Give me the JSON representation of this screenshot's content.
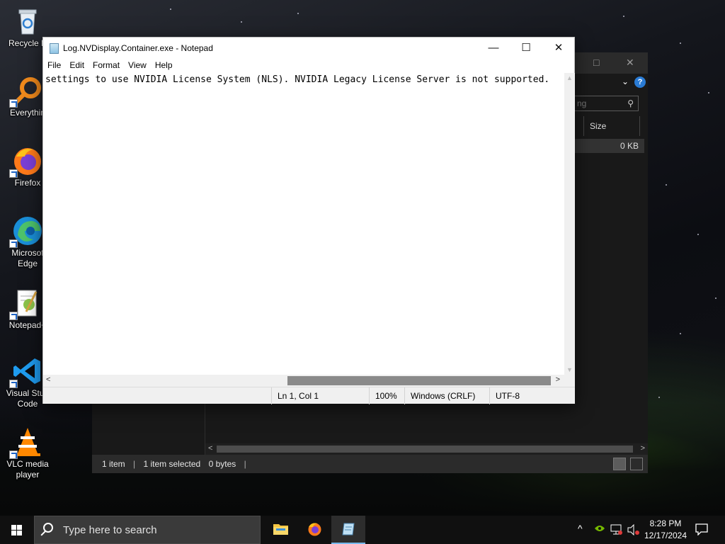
{
  "desktop": {
    "icons": [
      {
        "label": "Recycle Bin",
        "visible_label": "Recycle B",
        "icon": "recycle-bin-icon"
      },
      {
        "label": "Everything",
        "visible_label": "Everythin",
        "icon": "everything-search-icon"
      },
      {
        "label": "Firefox",
        "visible_label": "Firefox",
        "icon": "firefox-icon"
      },
      {
        "label": "Microsoft Edge",
        "visible_label_1": "Microsof",
        "visible_label_2": "Edge",
        "icon": "edge-icon"
      },
      {
        "label": "Notepad++",
        "visible_label": "Notepad+",
        "icon": "notepadpp-icon"
      },
      {
        "label": "Visual Studio Code",
        "visible_label_1": "Visual Stud",
        "visible_label_2": "Code",
        "icon": "vscode-icon"
      },
      {
        "label": "VLC media player",
        "visible_label_1": "VLC media",
        "visible_label_2": "player",
        "icon": "vlc-icon"
      }
    ]
  },
  "explorer": {
    "search_placeholder": "ng",
    "column_size": "Size",
    "row_size": "0 KB",
    "status": {
      "items": "1 item",
      "selected": "1 item selected",
      "bytes": "0 bytes"
    },
    "controls": {
      "maximize": "□",
      "close": "✕",
      "chevron": "⌄",
      "help": "?"
    }
  },
  "notepad": {
    "title": "Log.NVDisplay.Container.exe - Notepad",
    "controls": {
      "minimize": "—",
      "maximize": "☐",
      "close": "✕"
    },
    "menu": [
      "File",
      "Edit",
      "Format",
      "View",
      "Help"
    ],
    "content": "settings to use NVIDIA License System (NLS). NVIDIA Legacy License Server is not supported.",
    "status": {
      "position": "Ln 1, Col 1",
      "zoom": "100%",
      "line_ending": "Windows (CRLF)",
      "encoding": "UTF-8"
    }
  },
  "taskbar": {
    "search_placeholder": "Type here to search",
    "apps": [
      "file-explorer-icon",
      "firefox-icon",
      "notepad-icon"
    ],
    "clock": {
      "time": "8:28 PM",
      "date": "12/17/2024"
    }
  }
}
